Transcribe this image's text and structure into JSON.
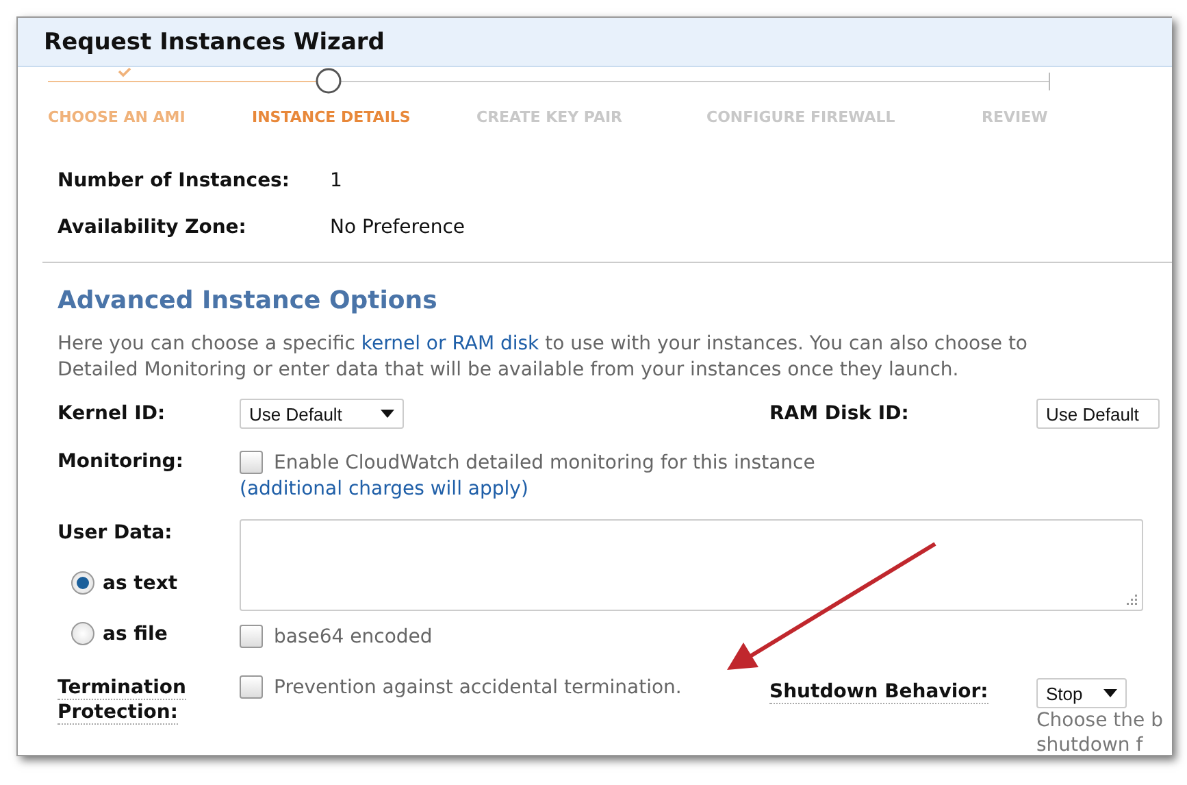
{
  "window": {
    "title": "Request Instances Wizard"
  },
  "steps": [
    {
      "label": "CHOOSE AN AMI",
      "completed": true,
      "selected": false
    },
    {
      "label": "INSTANCE DETAILS",
      "completed": false,
      "selected": true
    },
    {
      "label": "CREATE KEY PAIR",
      "completed": false,
      "selected": false
    },
    {
      "label": "CONFIGURE FIREWALL",
      "completed": false,
      "selected": false
    },
    {
      "label": "REVIEW",
      "completed": false,
      "selected": false
    }
  ],
  "summary": [
    {
      "label": "Number of Instances:",
      "value": "1"
    },
    {
      "label": "Availability Zone:",
      "value": "No Preference"
    }
  ],
  "advanced": {
    "heading": "Advanced Instance Options",
    "description": {
      "before": "Here you can choose a specific ",
      "link": "kernel or RAM disk",
      "after": " to use with your instances. You can also choose to",
      "line2": "Detailed Monitoring or enter data that will be available from your instances once they launch."
    },
    "kernel": {
      "label": "Kernel ID:",
      "value": "Use Default"
    },
    "ram_disk": {
      "label": "RAM Disk ID:",
      "value": "Use Default"
    },
    "monitoring": {
      "label": "Monitoring:",
      "checkbox": "Enable CloudWatch detailed monitoring for this instance",
      "checked": false,
      "link": "(additional charges will apply)"
    },
    "user_data": {
      "label": "User Data:",
      "options": [
        {
          "label": "as text",
          "selected": true
        },
        {
          "label": "as file",
          "selected": false
        }
      ],
      "base64": {
        "label": "base64 encoded",
        "checked": false
      }
    },
    "termination": {
      "label_lines": [
        "Termination",
        "Protection:"
      ],
      "checkbox": "Prevention against accidental termination.",
      "checked": false
    },
    "shutdown": {
      "label": "Shutdown Behavior:",
      "value": "Stop",
      "hint_lines": [
        "Choose the b",
        "shutdown f"
      ]
    }
  }
}
